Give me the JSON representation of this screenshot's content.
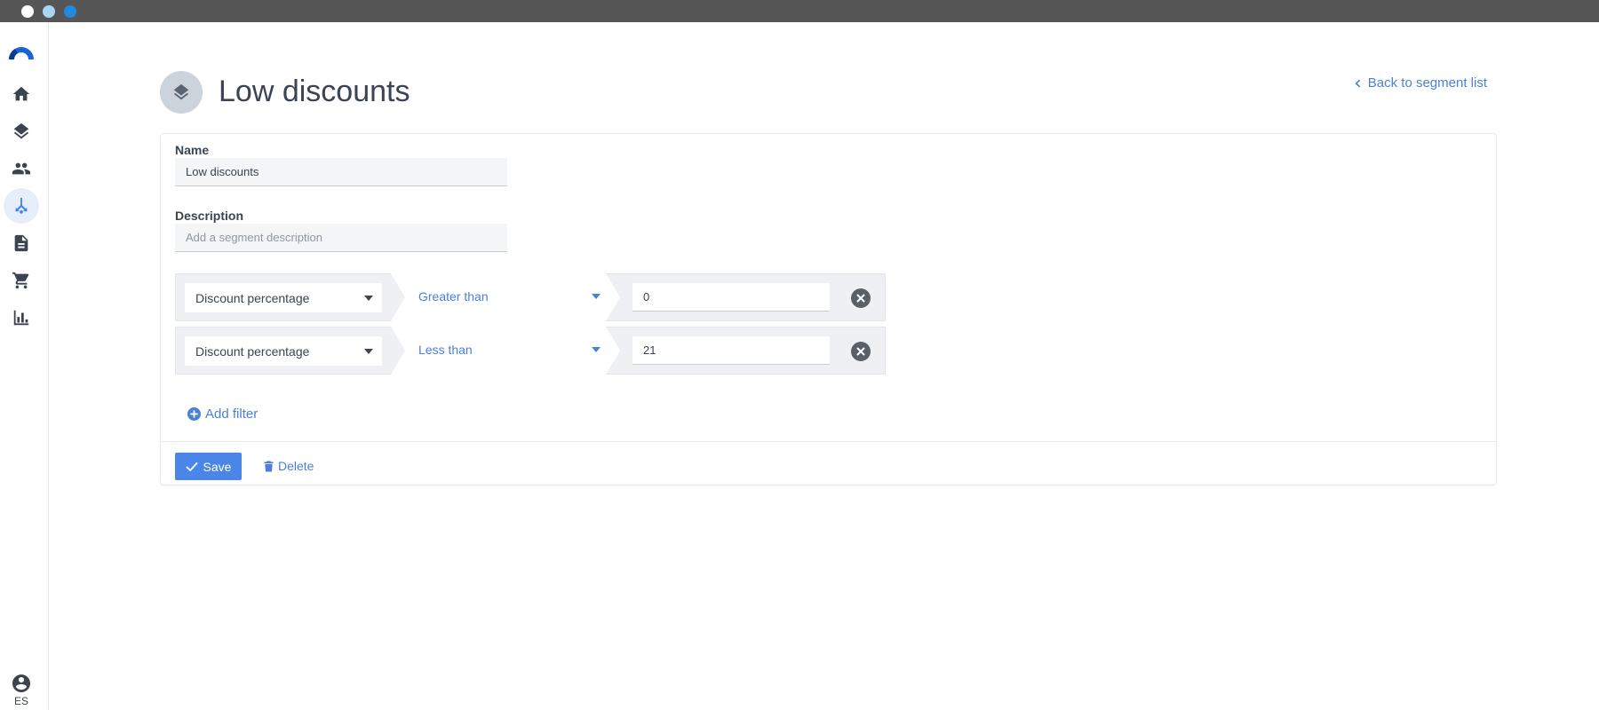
{
  "page": {
    "title": "Low discounts",
    "back_link": "Back to segment list"
  },
  "form": {
    "name_label": "Name",
    "name_value": "Low discounts",
    "description_label": "Description",
    "description_placeholder": "Add a segment description"
  },
  "filters": [
    {
      "field": "Discount percentage",
      "operator": "Greater than",
      "value": "0"
    },
    {
      "field": "Discount percentage",
      "operator": "Less than",
      "value": "21"
    }
  ],
  "actions": {
    "add_filter": "Add filter",
    "save": "Save",
    "delete": "Delete"
  },
  "sidebar": {
    "items": [
      "home-icon",
      "layers-icon",
      "people-icon",
      "segment-branch-icon",
      "document-icon",
      "cart-icon",
      "bar-chart-icon"
    ],
    "active": "segment-branch-icon",
    "user_initials": "ES"
  },
  "colors": {
    "accent": "#4a86e8",
    "link": "#4a7fdc",
    "titlebar": "#565656"
  }
}
